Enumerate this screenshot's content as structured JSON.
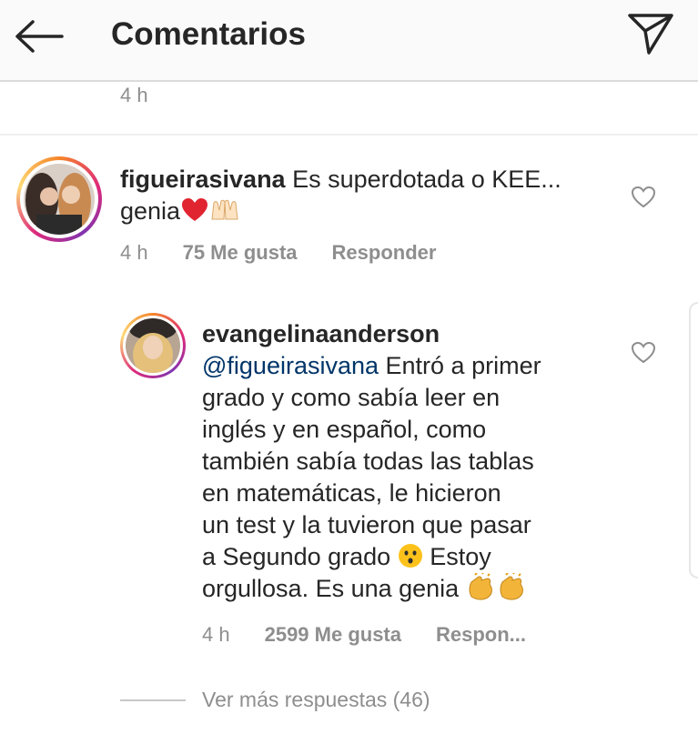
{
  "header": {
    "title": "Comentarios"
  },
  "previous_comment": {
    "time": "4 h"
  },
  "comments": [
    {
      "username": "figueirasivana",
      "text": " Es superdotada o KEE...",
      "text_line2": "genia",
      "time": "4 h",
      "likes": "75 Me gusta",
      "reply_label": "Responder"
    },
    {
      "username": "evangelinaanderson",
      "mention": "@figueirasivana",
      "text_first": " Entró a primer",
      "lines": [
        "grado y como sabía leer en",
        "inglés y en español, como",
        "también sabía todas las tablas",
        "en matemáticas, le hicieron",
        "un test y la tuvieron que pasar"
      ],
      "line_emoji_before": "a Segundo grado",
      "line_emoji_after": " Estoy",
      "last_line": "orgullosa. Es una genia",
      "time": "4 h",
      "likes": "2599 Me gusta",
      "reply_label": "Respon..."
    }
  ],
  "more_replies": "Ver más respuestas (46)",
  "icons": {
    "back": "arrow-left-icon",
    "send": "paper-plane-icon",
    "like": "heart-outline-icon",
    "heart_emoji": "red-heart-emoji",
    "hands_emoji": "raising-hands-emoji",
    "hushed_emoji": "hushed-face-emoji",
    "clap_emoji": "clapping-hands-emoji"
  }
}
